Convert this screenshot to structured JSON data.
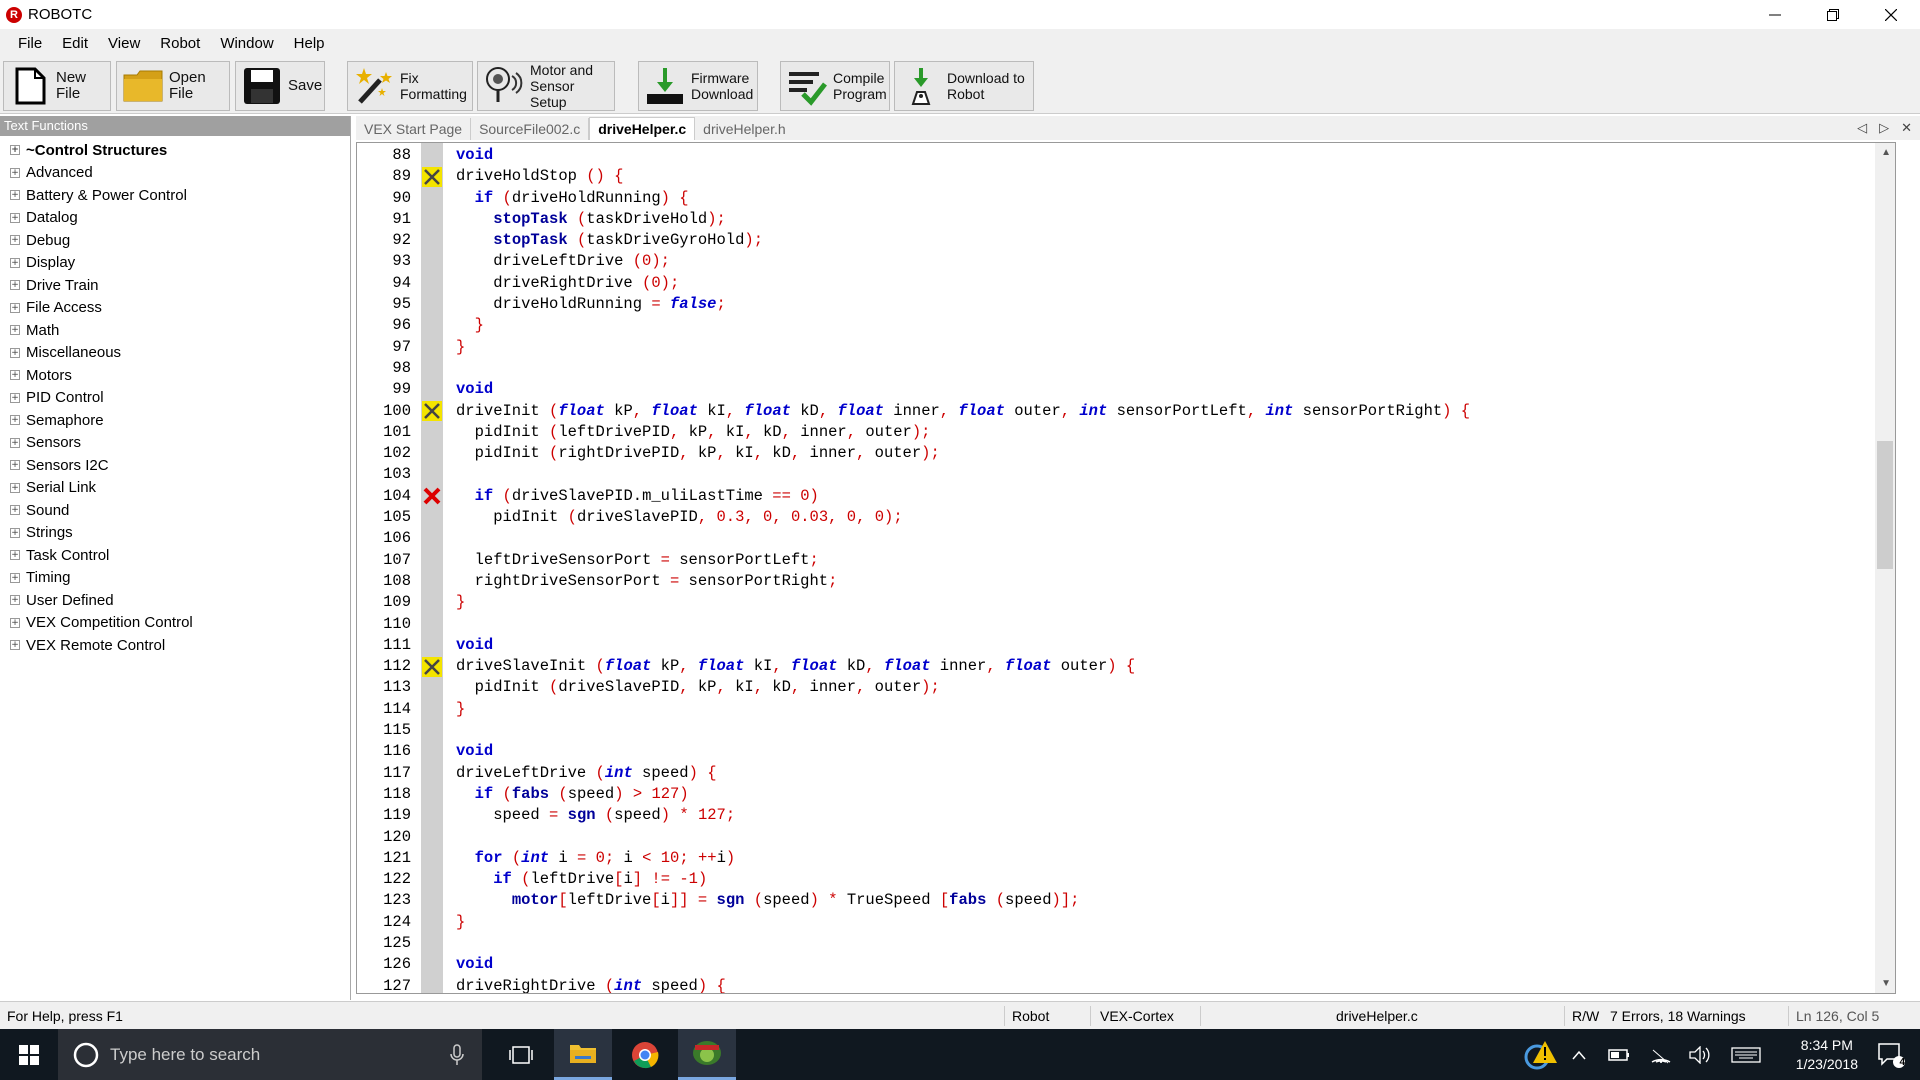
{
  "window": {
    "title": "ROBOTC",
    "logo": "R"
  },
  "menu": [
    "File",
    "Edit",
    "View",
    "Robot",
    "Window",
    "Help"
  ],
  "toolbar": [
    {
      "label": "New File",
      "icon": "new-file-icon"
    },
    {
      "label": "Open File",
      "icon": "folder-icon"
    },
    {
      "label": "Save",
      "icon": "save-icon"
    },
    {
      "label": "Fix\nFormatting",
      "icon": "magic-wand-icon"
    },
    {
      "label": "Motor and\nSensor Setup",
      "icon": "motor-sensor-icon"
    },
    {
      "label": "Firmware\nDownload",
      "icon": "firmware-download-icon"
    },
    {
      "label": "Compile\nProgram",
      "icon": "compile-icon"
    },
    {
      "label": "Download to\nRobot",
      "icon": "download-robot-icon"
    }
  ],
  "sidebar": {
    "header": "Text Functions",
    "items": [
      "~Control Structures",
      "Advanced",
      "Battery & Power Control",
      "Datalog",
      "Debug",
      "Display",
      "Drive Train",
      "File Access",
      "Math",
      "Miscellaneous",
      "Motors",
      "PID Control",
      "Semaphore",
      "Sensors",
      "Sensors I2C",
      "Serial Link",
      "Sound",
      "Strings",
      "Task Control",
      "Timing",
      "User Defined",
      "VEX Competition Control",
      "VEX Remote Control"
    ]
  },
  "tabs": [
    "VEX Start Page",
    "SourceFile002.c",
    "driveHelper.c",
    "driveHelper.h"
  ],
  "active_tab": "driveHelper.c",
  "tab_controls": [
    "◁",
    "▷",
    "✕"
  ],
  "code": [
    {
      "n": "88",
      "m": "",
      "t": "void"
    },
    {
      "n": "89",
      "m": "warn",
      "t": "driveHoldStop () {"
    },
    {
      "n": "90",
      "m": "",
      "t": "  if (driveHoldRunning) {"
    },
    {
      "n": "91",
      "m": "",
      "t": "    stopTask (taskDriveHold);"
    },
    {
      "n": "92",
      "m": "",
      "t": "    stopTask (taskDriveGyroHold);"
    },
    {
      "n": "93",
      "m": "",
      "t": "    driveLeftDrive (0);"
    },
    {
      "n": "94",
      "m": "",
      "t": "    driveRightDrive (0);"
    },
    {
      "n": "95",
      "m": "",
      "t": "    driveHoldRunning = false;"
    },
    {
      "n": "96",
      "m": "",
      "t": "  }"
    },
    {
      "n": "97",
      "m": "",
      "t": "}"
    },
    {
      "n": "98",
      "m": "",
      "t": ""
    },
    {
      "n": "99",
      "m": "",
      "t": "void"
    },
    {
      "n": "100",
      "m": "warn",
      "t": "driveInit (float kP, float kI, float kD, float inner, float outer, int sensorPortLeft, int sensorPortRight) {"
    },
    {
      "n": "101",
      "m": "",
      "t": "  pidInit (leftDrivePID, kP, kI, kD, inner, outer);"
    },
    {
      "n": "102",
      "m": "",
      "t": "  pidInit (rightDrivePID, kP, kI, kD, inner, outer);"
    },
    {
      "n": "103",
      "m": "",
      "t": ""
    },
    {
      "n": "104",
      "m": "error",
      "t": "  if (driveSlavePID.m_uliLastTime == 0)"
    },
    {
      "n": "105",
      "m": "",
      "t": "    pidInit (driveSlavePID, 0.3, 0, 0.03, 0, 0);"
    },
    {
      "n": "106",
      "m": "",
      "t": ""
    },
    {
      "n": "107",
      "m": "",
      "t": "  leftDriveSensorPort = sensorPortLeft;"
    },
    {
      "n": "108",
      "m": "",
      "t": "  rightDriveSensorPort = sensorPortRight;"
    },
    {
      "n": "109",
      "m": "",
      "t": "}"
    },
    {
      "n": "110",
      "m": "",
      "t": ""
    },
    {
      "n": "111",
      "m": "",
      "t": "void"
    },
    {
      "n": "112",
      "m": "warn",
      "t": "driveSlaveInit (float kP, float kI, float kD, float inner, float outer) {"
    },
    {
      "n": "113",
      "m": "",
      "t": "  pidInit (driveSlavePID, kP, kI, kD, inner, outer);"
    },
    {
      "n": "114",
      "m": "",
      "t": "}"
    },
    {
      "n": "115",
      "m": "",
      "t": ""
    },
    {
      "n": "116",
      "m": "",
      "t": "void"
    },
    {
      "n": "117",
      "m": "",
      "t": "driveLeftDrive (int speed) {"
    },
    {
      "n": "118",
      "m": "",
      "t": "  if (fabs (speed) > 127)"
    },
    {
      "n": "119",
      "m": "",
      "t": "    speed = sgn (speed) * 127;"
    },
    {
      "n": "120",
      "m": "",
      "t": ""
    },
    {
      "n": "121",
      "m": "",
      "t": "  for (int i = 0; i < 10; ++i)"
    },
    {
      "n": "122",
      "m": "",
      "t": "    if (leftDrive[i] != -1)"
    },
    {
      "n": "123",
      "m": "",
      "t": "      motor[leftDrive[i]] = sgn (speed) * TrueSpeed [fabs (speed)];"
    },
    {
      "n": "124",
      "m": "",
      "t": "}"
    },
    {
      "n": "125",
      "m": "",
      "t": ""
    },
    {
      "n": "126",
      "m": "",
      "t": "void"
    },
    {
      "n": "127",
      "m": "",
      "t": "driveRightDrive (int speed) {"
    }
  ],
  "status": {
    "help": "For Help, press F1",
    "robot": "Robot",
    "platform": "VEX-Cortex",
    "file": "driveHelper.c",
    "mode": "R/W",
    "errors": "7 Errors, 18 Warnings",
    "position": "Ln 126, Col 5"
  },
  "taskbar": {
    "search_placeholder": "Type here to search",
    "time": "8:34 PM",
    "date": "1/23/2018",
    "notifications": "4"
  }
}
